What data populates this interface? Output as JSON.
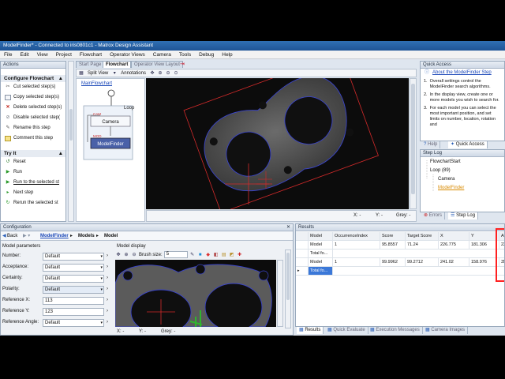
{
  "window": {
    "title": "ModelFinder* - Connected to iris0801c1 - Matrox Design Assistant"
  },
  "menu": [
    "File",
    "Edit",
    "View",
    "Project",
    "Flowchart",
    "Operator Views",
    "Camera",
    "Tools",
    "Debug",
    "Help"
  ],
  "left_panel": {
    "header": "Actions",
    "configure_title": "Configure Flowchart",
    "configure_items": [
      "Cut selected step(s)",
      "Copy selected step(s)",
      "Delete selected step(s)",
      "Disable selected step(",
      "Rename this step",
      "Comment this step"
    ],
    "try_title": "Try It",
    "try_items": [
      "Reset",
      "Run",
      "Run to the selected st",
      "Next step",
      "Rerun the selected st"
    ]
  },
  "center": {
    "tabs": [
      "Start Page",
      "Flowchart",
      "Operator View Layout"
    ],
    "toolbar": {
      "split_view": "Split View",
      "annotations": "Annotations"
    },
    "main_flowchart_link": "MainFlowchart",
    "flow": {
      "loop_label": "Loop",
      "cam_tag": "CAM",
      "camera": "Camera",
      "mod_tag": "MOD",
      "model_finder": "ModelFinder"
    },
    "status": {
      "x": "X: -",
      "y": "Y: -",
      "grey": "Grey: -"
    }
  },
  "quick_access": {
    "header": "Quick Access",
    "link": "About the ModelFinder Step",
    "bullets": [
      "Overall settings control the ModelFinder search algorithms.",
      "In the display view, create one or more models you wish to search for.",
      "For each model you can select the most important position, and set limits on number, location, rotation and"
    ],
    "tabs": [
      "Help",
      "Quick Access"
    ]
  },
  "step_log": {
    "header": "Step Log",
    "items": [
      "FlowchartStart",
      "Loop (89)",
      "Camera",
      "ModelFinder"
    ],
    "tabs": [
      "Errors",
      "Step Log"
    ]
  },
  "configuration": {
    "header": "Configuration",
    "breadcrumb": [
      "Back",
      "ModelFinder",
      "Models",
      "Model"
    ],
    "params_title": "Model parameters",
    "params": [
      {
        "label": "Number:",
        "value": "Default"
      },
      {
        "label": "Acceptance:",
        "value": "Default"
      },
      {
        "label": "Certainty:",
        "value": "Default"
      },
      {
        "label": "Polarity:",
        "value": "Default"
      },
      {
        "label": "Reference X:",
        "value": "113"
      },
      {
        "label": "Reference Y:",
        "value": "123"
      },
      {
        "label": "Reference Angle:",
        "value": "Default"
      }
    ],
    "display_title": "Model display",
    "brush_label": "Brush size:",
    "brush_value": "5",
    "status": {
      "x": "X: -",
      "y": "Y: -",
      "grey": "Grey: -"
    }
  },
  "results": {
    "header": "Results",
    "columns": [
      "Model",
      "OccurrenceIndex",
      "Score",
      "Target Score",
      "X",
      "Y",
      "A"
    ],
    "rows": [
      [
        "Model",
        "1",
        "95.8557",
        "71.24",
        "226.775",
        "181.306",
        "22"
      ],
      [
        "Total fo...",
        "",
        "",
        "",
        "",
        "",
        ""
      ],
      [
        "Model",
        "1",
        "99.9962",
        "99.2712",
        "241.02",
        "158.976",
        "35"
      ],
      [
        "Total fo...",
        "",
        "",
        "",
        "",
        "",
        ""
      ]
    ],
    "bottom_tabs": [
      "Results",
      "Quick Evaluate",
      "Execution Messages",
      "Camera Images"
    ]
  },
  "colors": {
    "accent": "#2f6fb3",
    "model_box": "#3a44c8",
    "crosshair": "#d42a2a",
    "highlight_red": "#ff2020"
  }
}
